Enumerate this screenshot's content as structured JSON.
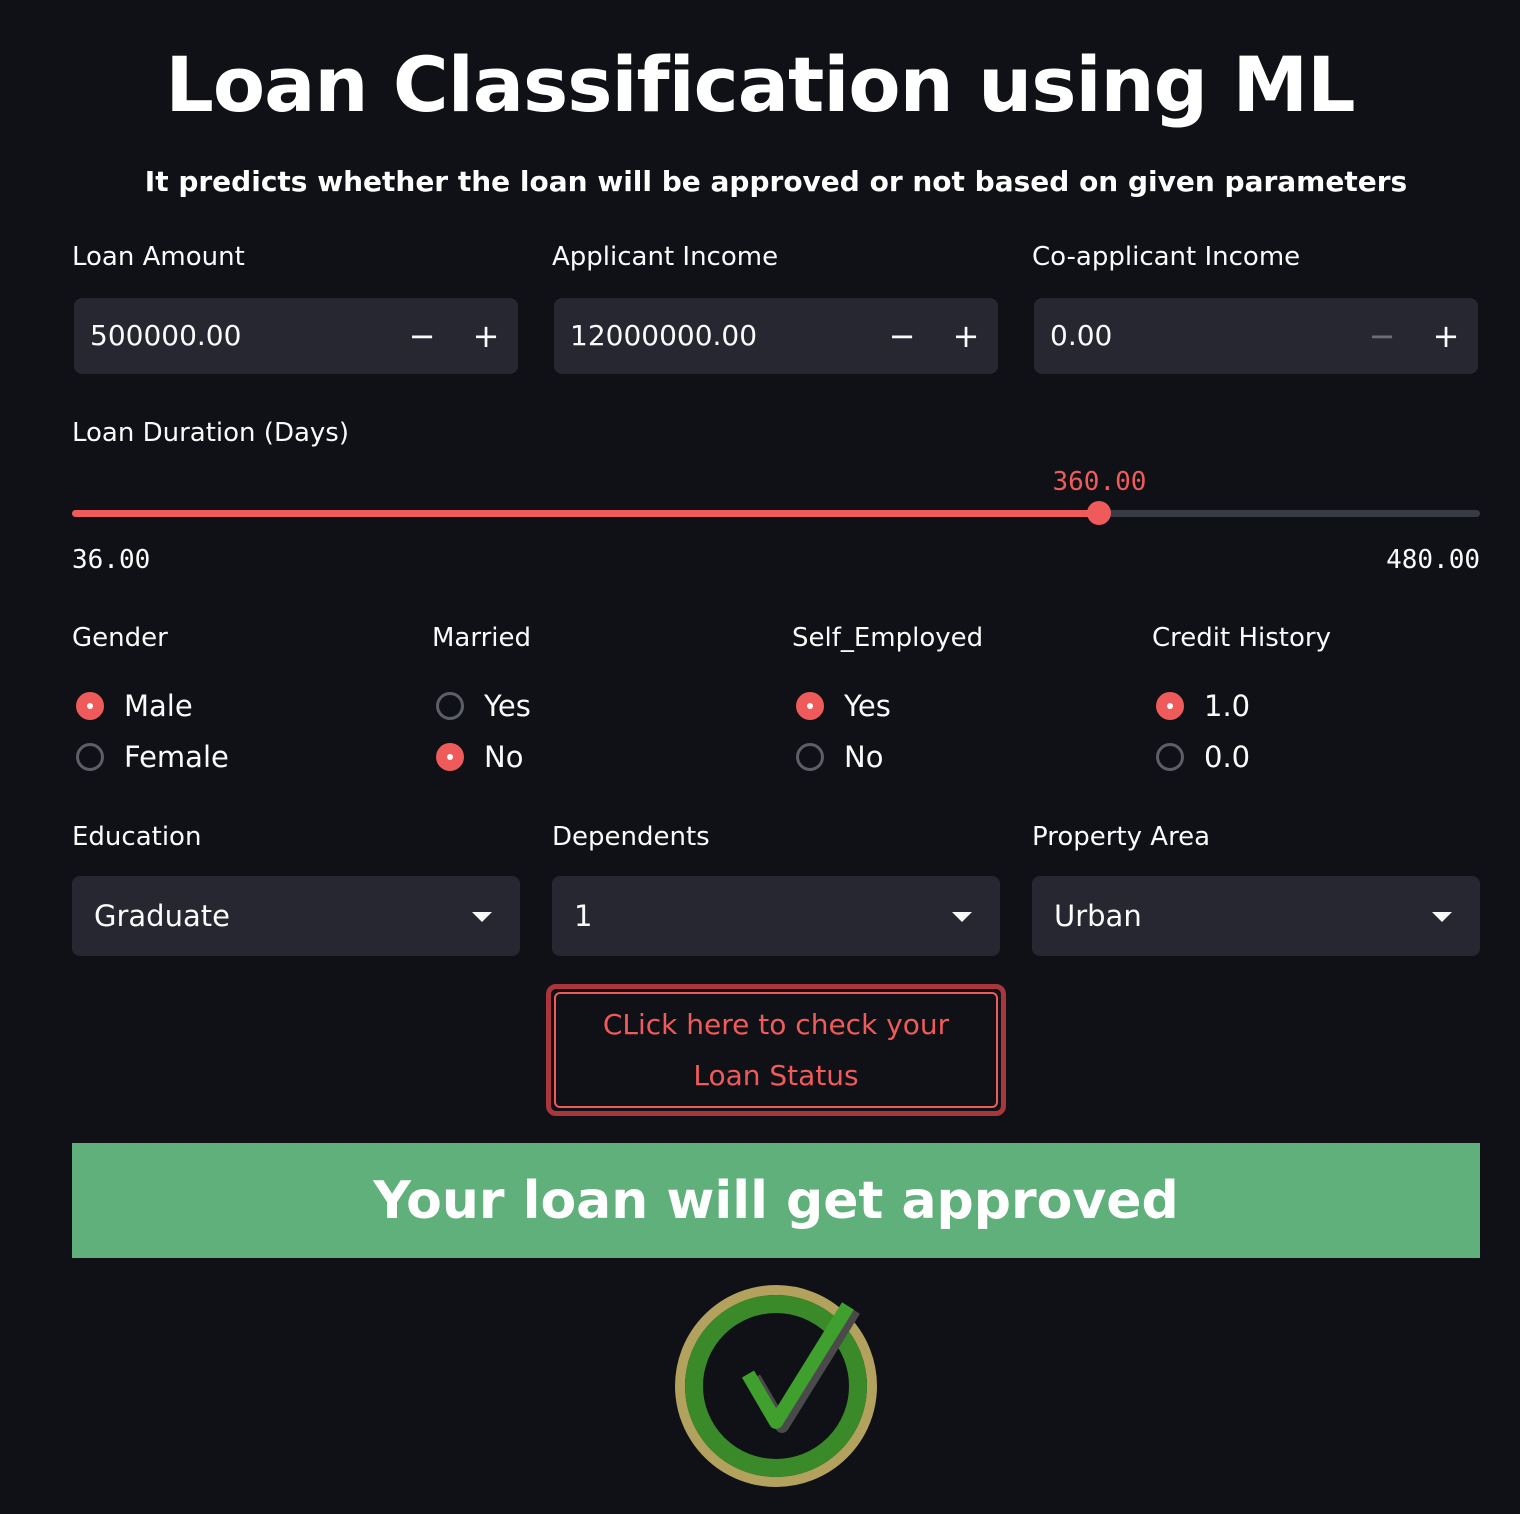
{
  "header": {
    "title": "Loan Classification using ML",
    "subtitle": "It predicts whether the loan will be approved or not based on given parameters"
  },
  "inputs": {
    "loan_amount": {
      "label": "Loan Amount",
      "value": "500000.00",
      "minus": "−",
      "plus": "+"
    },
    "applicant_income": {
      "label": "Applicant Income",
      "value": "12000000.00",
      "minus": "−",
      "plus": "+"
    },
    "coapplicant_income": {
      "label": "Co-applicant Income",
      "value": "0.00",
      "minus": "−",
      "plus": "+"
    }
  },
  "slider": {
    "label": "Loan Duration (Days)",
    "value": 360,
    "value_text": "360.00",
    "min": 36,
    "min_text": "36.00",
    "max": 480,
    "max_text": "480.00"
  },
  "radios": {
    "gender": {
      "label": "Gender",
      "options": [
        "Male",
        "Female"
      ],
      "selected": "Male"
    },
    "married": {
      "label": "Married",
      "options": [
        "Yes",
        "No"
      ],
      "selected": "No"
    },
    "self_employed": {
      "label": "Self_Employed",
      "options": [
        "Yes",
        "No"
      ],
      "selected": "Yes"
    },
    "credit_history": {
      "label": "Credit History",
      "options": [
        "1.0",
        "0.0"
      ],
      "selected": "1.0"
    }
  },
  "selects": {
    "education": {
      "label": "Education",
      "value": "Graduate"
    },
    "dependents": {
      "label": "Dependents",
      "value": "1"
    },
    "property_area": {
      "label": "Property Area",
      "value": "Urban"
    }
  },
  "action": {
    "button_line1": "CLick here to check your",
    "button_line2": "Loan Status"
  },
  "result": {
    "message": "Your loan will get approved",
    "icon": "check-circle-icon"
  },
  "colors": {
    "background": "#0f1117",
    "accent": "#ef5a5a",
    "success": "#5fb07a",
    "input_bg": "#262730"
  }
}
